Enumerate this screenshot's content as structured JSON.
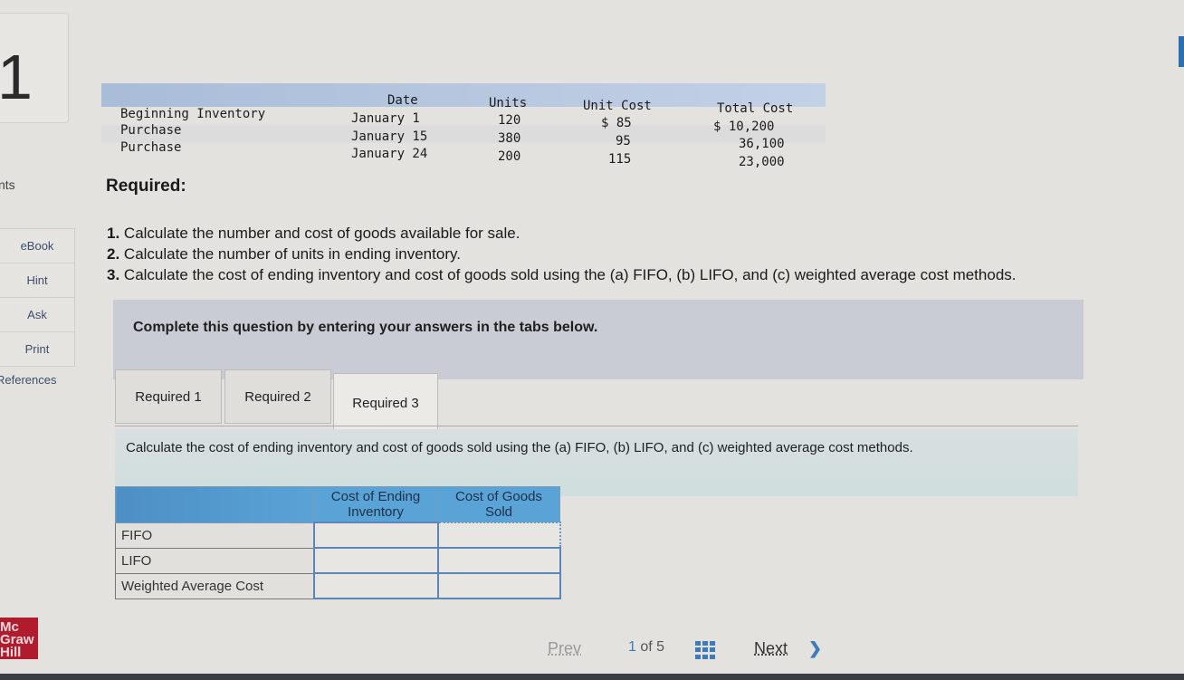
{
  "question": {
    "number": "1",
    "points_label": "nts"
  },
  "sidebar": {
    "items": [
      {
        "label": "eBook"
      },
      {
        "label": "Hint"
      },
      {
        "label": "Ask"
      },
      {
        "label": "Print"
      },
      {
        "label": "References"
      }
    ]
  },
  "inventory_table": {
    "headers": {
      "date": "Date",
      "units": "Units",
      "unit_cost": "Unit Cost",
      "total_cost": "Total Cost"
    },
    "rows": [
      {
        "label": "Beginning Inventory",
        "date": "January 1",
        "units": "120",
        "unit_cost": "$ 85",
        "total_cost": "$ 10,200"
      },
      {
        "label": "Purchase",
        "date": "January 15",
        "units": "380",
        "unit_cost": "95",
        "total_cost": "36,100"
      },
      {
        "label": "Purchase",
        "date": "January 24",
        "units": "200",
        "unit_cost": "115",
        "total_cost": "23,000"
      }
    ]
  },
  "required": {
    "title": "Required:",
    "items": [
      {
        "num": "1.",
        "text": "Calculate the number and cost of goods available for sale."
      },
      {
        "num": "2.",
        "text": "Calculate the number of units in ending inventory."
      },
      {
        "num": "3.",
        "text": "Calculate the cost of ending inventory and cost of goods sold using the (a) FIFO, (b) LIFO, and (c) weighted average cost methods."
      }
    ]
  },
  "banner": {
    "text": "Complete this question by entering your answers in the tabs below."
  },
  "tabs": [
    {
      "label": "Required 1",
      "active": false
    },
    {
      "label": "Required 2",
      "active": false
    },
    {
      "label": "Required 3",
      "active": true
    }
  ],
  "instruction": "Calculate the cost of ending inventory and cost of goods sold using the (a) FIFO, (b) LIFO, and (c) weighted average cost methods.",
  "answer_table": {
    "headers": {
      "ending_inventory": "Cost of Ending Inventory",
      "cogs": "Cost of Goods Sold"
    },
    "rows": [
      {
        "label": "FIFO",
        "ending_inventory": "",
        "cogs": ""
      },
      {
        "label": "LIFO",
        "ending_inventory": "",
        "cogs": ""
      },
      {
        "label": "Weighted Average Cost",
        "ending_inventory": "",
        "cogs": ""
      }
    ]
  },
  "logo": {
    "line1": "Mc",
    "line2": "Graw",
    "line3": "Hill"
  },
  "pager": {
    "prev": "Prev",
    "current": "1",
    "of": "of",
    "total": "5",
    "next": "Next",
    "next_icon": "chevron-right"
  }
}
